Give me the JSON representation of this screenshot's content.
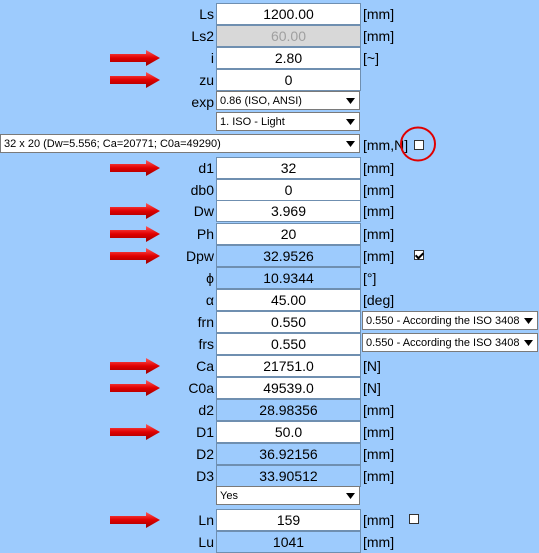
{
  "rows": [
    {
      "label": "Ls",
      "value": "1200.00",
      "unit": "[mm]"
    },
    {
      "label": "Ls2",
      "value": "60.00",
      "unit": "[mm]"
    },
    {
      "label": "i",
      "value": "2.80",
      "unit": "[~]"
    },
    {
      "label": "zu",
      "value": "0",
      "unit": ""
    },
    {
      "label": "exp",
      "select": "0.86 (ISO, ANSI)"
    },
    {
      "label": "",
      "select": "1. ISO - Light"
    },
    {
      "label": "",
      "select": "32 x 20   (Dw=5.556;  Ca=20771;  C0a=49290)",
      "unit": "[mm,N]"
    },
    {
      "label": "d1",
      "value": "32",
      "unit": "[mm]"
    },
    {
      "label": "db0",
      "value": "0",
      "unit": "[mm]"
    },
    {
      "label": "Dw",
      "value": "3.969",
      "unit": "[mm]"
    },
    {
      "label": "Ph",
      "value": "20",
      "unit": "[mm]"
    },
    {
      "label": "Dpw",
      "value": "32.9526",
      "unit": "[mm]"
    },
    {
      "label": "ϕ",
      "value": "10.9344",
      "unit": "[°]"
    },
    {
      "label": "α",
      "value": "45.00",
      "unit": "[deg]"
    },
    {
      "label": "frn",
      "value": "0.550",
      "select": "0.550 - According the ISO 3408"
    },
    {
      "label": "frs",
      "value": "0.550",
      "select": "0.550 - According the ISO 3408"
    },
    {
      "label": "Ca",
      "value": "21751.0",
      "unit": "[N]"
    },
    {
      "label": "C0a",
      "value": "49539.0",
      "unit": "[N]"
    },
    {
      "label": "d2",
      "value": "28.98356",
      "unit": "[mm]"
    },
    {
      "label": "D1",
      "value": "50.0",
      "unit": "[mm]"
    },
    {
      "label": "D2",
      "value": "36.92156",
      "unit": "[mm]"
    },
    {
      "label": "D3",
      "value": "33.90512",
      "unit": "[mm]"
    },
    {
      "label": "",
      "select": "Yes"
    },
    {
      "label": "Ln",
      "value": "159",
      "unit": "[mm]"
    },
    {
      "label": "Lu",
      "value": "1041",
      "unit": "[mm]"
    }
  ],
  "colors": {
    "background": "#9DCBFD",
    "arrow": "#e00000",
    "highlight_circle": "#e00000"
  },
  "checkboxes": {
    "table_link": false,
    "dpw_override": true,
    "ln_override": false
  }
}
